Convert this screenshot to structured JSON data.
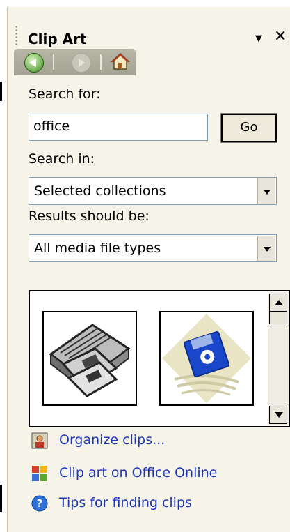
{
  "pane": {
    "title": "Clip Art"
  },
  "nav": {
    "back_icon": "back-arrow-icon",
    "forward_icon": "forward-arrow-icon",
    "home_icon": "home-icon"
  },
  "search": {
    "search_for_label": "Search for:",
    "query": "office",
    "go_label": "Go",
    "search_in_label": "Search in:",
    "search_in_value": "Selected collections",
    "results_label": "Results should be:",
    "results_value": "All media file types"
  },
  "results": {
    "items": [
      {
        "icon": "floppy-disks-clipart"
      },
      {
        "icon": "blue-floppy-disk-clipart"
      }
    ]
  },
  "links": [
    {
      "label": "Organize clips...",
      "icon": "organize-clips-icon"
    },
    {
      "label": "Clip art on Office Online",
      "icon": "office-online-icon"
    },
    {
      "label": "Tips for finding clips",
      "icon": "help-icon"
    }
  ],
  "colors": {
    "pane_bg": "#f6f4e9",
    "link": "#1d34b8",
    "nav_bar": "#b0ae9e"
  }
}
